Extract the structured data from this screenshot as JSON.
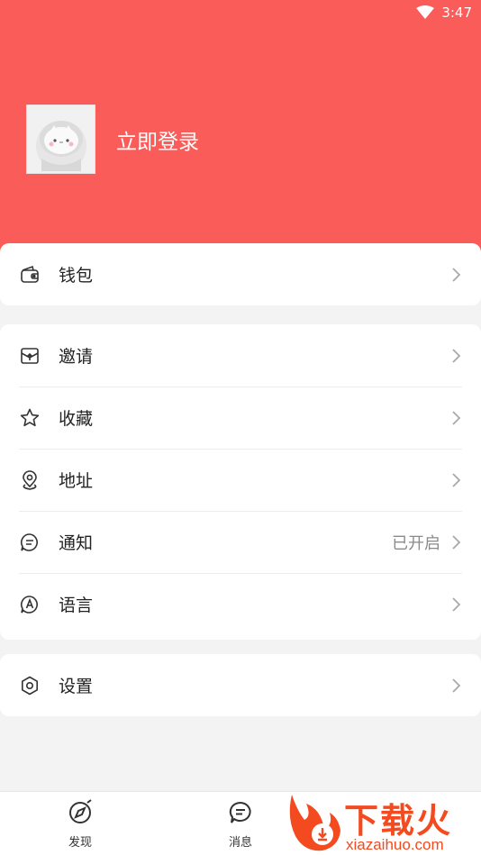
{
  "status_bar": {
    "time": "3:47",
    "wifi_icon": "wifi-icon"
  },
  "profile": {
    "login_label": "立即登录",
    "avatar_icon": "avatar-placeholder-icon"
  },
  "menu_group_1": [
    {
      "label": "钱包",
      "icon": "wallet-icon",
      "value": ""
    }
  ],
  "menu_group_2": [
    {
      "label": "邀请",
      "icon": "invite-icon",
      "value": ""
    },
    {
      "label": "收藏",
      "icon": "star-icon",
      "value": ""
    },
    {
      "label": "地址",
      "icon": "location-icon",
      "value": ""
    },
    {
      "label": "通知",
      "icon": "message-icon",
      "value": "已开启"
    },
    {
      "label": "语言",
      "icon": "language-icon",
      "value": ""
    }
  ],
  "menu_group_3": [
    {
      "label": "设置",
      "icon": "gear-icon",
      "value": ""
    }
  ],
  "tabbar": [
    {
      "label": "发现",
      "icon": "compass-icon"
    },
    {
      "label": "消息",
      "icon": "chat-icon"
    }
  ],
  "watermark": {
    "title": "下载火",
    "subtitle": "xiazaihuo.com"
  },
  "colors": {
    "header": "#f95c59",
    "background": "#f3f3f3",
    "watermark": "#f34a1f"
  }
}
